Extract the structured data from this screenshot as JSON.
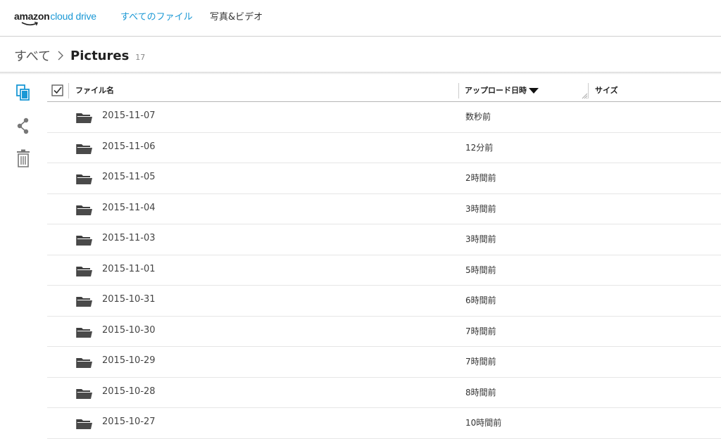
{
  "header": {
    "logo_amazon": "amazon",
    "logo_cloud": "cloud drive",
    "nav": {
      "all_files": "すべてのファイル",
      "photos_videos": "写真&ビデオ"
    }
  },
  "breadcrumb": {
    "root": "すべて",
    "current": "Pictures",
    "count": "17"
  },
  "sidebar_actions": [
    {
      "icon": "copy-icon"
    },
    {
      "icon": "share-icon"
    },
    {
      "icon": "trash-icon"
    }
  ],
  "table": {
    "columns": {
      "name": "ファイル名",
      "uploaded": "アップロード日時",
      "size": "サイズ"
    },
    "sort": {
      "column": "uploaded",
      "direction": "descending"
    },
    "rows": [
      {
        "name": "2015-11-07",
        "uploaded": "数秒前"
      },
      {
        "name": "2015-11-06",
        "uploaded": "12分前"
      },
      {
        "name": "2015-11-05",
        "uploaded": "2時間前"
      },
      {
        "name": "2015-11-04",
        "uploaded": "3時間前"
      },
      {
        "name": "2015-11-03",
        "uploaded": "3時間前"
      },
      {
        "name": "2015-11-01",
        "uploaded": "5時間前"
      },
      {
        "name": "2015-10-31",
        "uploaded": "6時間前"
      },
      {
        "name": "2015-10-30",
        "uploaded": "7時間前"
      },
      {
        "name": "2015-10-29",
        "uploaded": "7時間前"
      },
      {
        "name": "2015-10-28",
        "uploaded": "8時間前"
      },
      {
        "name": "2015-10-27",
        "uploaded": "10時間前"
      }
    ]
  },
  "colors": {
    "accent": "#1a98d5",
    "text": "#333333",
    "folder": "#4a4a4a"
  }
}
